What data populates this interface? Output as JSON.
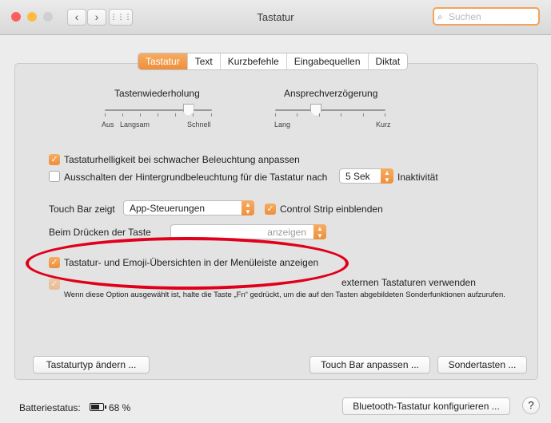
{
  "window": {
    "title": "Tastatur",
    "search_placeholder": "Suchen",
    "grid_icon": "⋮⋮⋮"
  },
  "tabs": [
    "Tastatur",
    "Text",
    "Kurzbefehle",
    "Eingabequellen",
    "Diktat"
  ],
  "sliders": {
    "repeat": {
      "label": "Tastenwiederholung",
      "left": "Aus",
      "left2": "Langsam",
      "right": "Schnell",
      "level": 0.78
    },
    "delay": {
      "label": "Ansprechverzögerung",
      "left": "Lang",
      "right": "Kurz",
      "level": 0.37
    }
  },
  "options": {
    "brightness": "Tastaturhelligkeit bei schwacher Beleuchtung anpassen",
    "backlight_off": "Ausschalten der Hintergrundbeleuchtung für die Tastatur nach",
    "backlight_value": "5 Sek",
    "inactivity": "Inaktivität",
    "touchbar_label": "Touch Bar zeigt",
    "touchbar_value": "App-Steuerungen",
    "control_strip": "Control Strip einblenden",
    "fn_label": "Beim Drücken der Taste",
    "fn_value": "anzeigen",
    "emoji_viewer": "Tastatur- und Emoji-Übersichten in der Menüleiste anzeigen",
    "fkeys_end": "externen Tastaturen verwenden",
    "fkeys_desc": "Wenn diese Option ausgewählt ist, halte die Taste „Fn“ gedrückt, um die auf den Tasten abgebildeten Sonderfunktionen aufzurufen."
  },
  "buttons": {
    "change_type": "Tastaturtyp ändern ...",
    "touchbar_customize": "Touch Bar anpassen ...",
    "modifier_keys": "Sondertasten ...",
    "bluetooth": "Bluetooth-Tastatur konfigurieren ...",
    "help": "?"
  },
  "battery": {
    "label": "Batteriestatus:",
    "percent": "68 %"
  },
  "colors": {
    "accent": "#ee8f3c",
    "highlight_ring": "#e0001b"
  }
}
